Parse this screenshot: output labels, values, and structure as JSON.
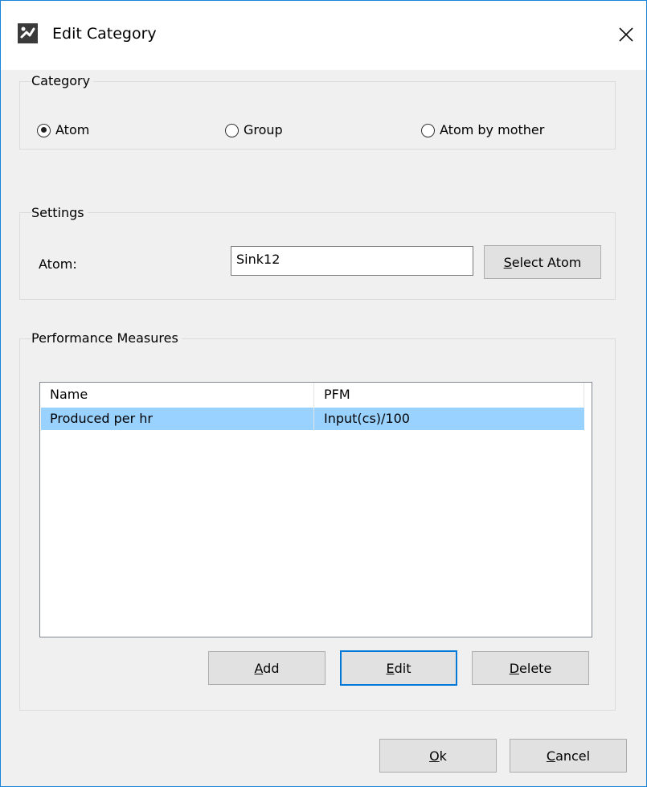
{
  "window": {
    "title": "Edit Category",
    "accent_color": "#1883d7"
  },
  "icons": {
    "app": "app-logo-icon",
    "close": "close-icon"
  },
  "category": {
    "title": "Category",
    "options": [
      {
        "label": "Atom",
        "checked": true
      },
      {
        "label": "Group",
        "checked": false
      },
      {
        "label": "Atom by mother",
        "checked": false
      }
    ]
  },
  "settings": {
    "title": "Settings",
    "atom_label": "Atom:",
    "atom_value": "Sink12",
    "select_button": {
      "mnemonic": "S",
      "rest": "elect Atom"
    }
  },
  "performance": {
    "title": "Performance Measures",
    "columns": [
      "Name",
      "PFM"
    ],
    "rows": [
      {
        "name": "Produced per hr",
        "pfm": "Input(cs)/100",
        "selected": true
      }
    ],
    "selected_color": "#99d1ff",
    "add_button": {
      "mnemonic": "A",
      "rest": "dd"
    },
    "edit_button": {
      "mnemonic": "E",
      "rest": "dit"
    },
    "delete_button": {
      "mnemonic": "D",
      "rest": "elete"
    }
  },
  "footer": {
    "ok_button": {
      "mnemonic": "O",
      "rest": "k"
    },
    "cancel_button": {
      "mnemonic": "C",
      "rest": "ancel"
    }
  }
}
